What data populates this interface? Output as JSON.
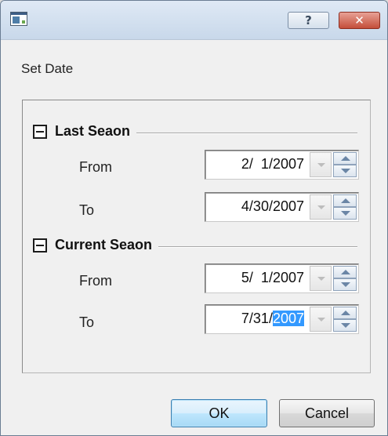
{
  "window": {
    "title": "",
    "help_label": "?",
    "close_label": "✕"
  },
  "heading": "Set Date",
  "sections": [
    {
      "title": "Last Seaon",
      "collapse_state": "expanded",
      "rows": [
        {
          "label": "From",
          "value": "2/  1/2007"
        },
        {
          "label": "To",
          "value": "4/30/2007"
        }
      ]
    },
    {
      "title": "Current Seaon",
      "collapse_state": "expanded",
      "rows": [
        {
          "label": "From",
          "value": "5/  1/2007"
        },
        {
          "label": "To",
          "value_prefix": "7/31/",
          "value_selected": "2007"
        }
      ]
    }
  ],
  "buttons": {
    "ok": "OK",
    "cancel": "Cancel"
  },
  "colors": {
    "selection": "#3399ff",
    "close_button": "#c44e3a"
  }
}
